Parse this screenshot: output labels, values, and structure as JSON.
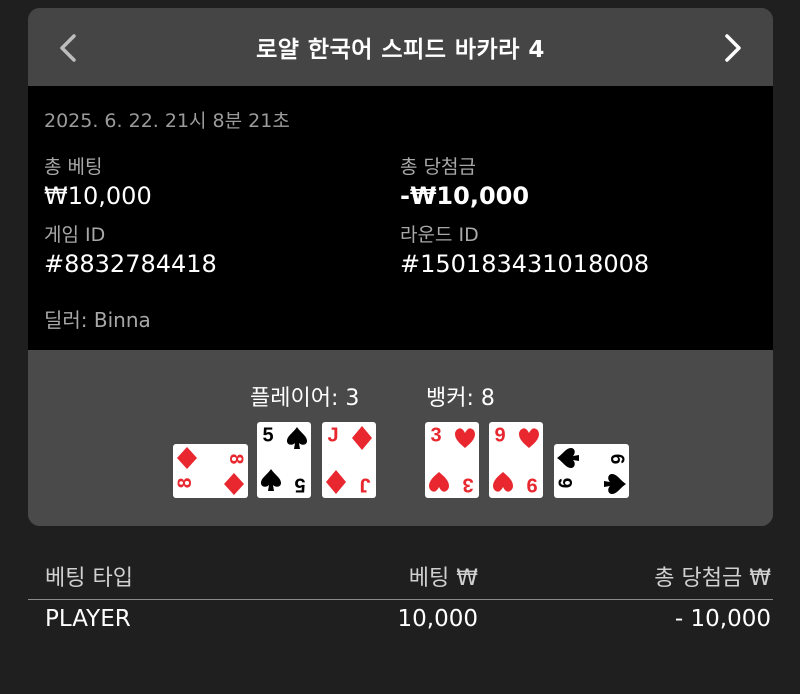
{
  "header": {
    "title": "로얄 한국어 스피드 바카라 4",
    "prev_icon": "chevron-left-icon",
    "next_icon": "chevron-right-icon"
  },
  "info": {
    "timestamp": "2025. 6. 22. 21시 8분 21초",
    "total_bet_label": "총 베팅",
    "total_bet_value": "₩10,000",
    "total_win_label": "총 당첨금",
    "total_win_value": "-₩10,000",
    "game_id_label": "게임 ID",
    "game_id_value": "#8832784418",
    "round_id_label": "라운드 ID",
    "round_id_value": "#150183431018008",
    "dealer": "딜러: Binna"
  },
  "hands": {
    "player_label": "플레이어: 3",
    "banker_label": "뱅커: 8",
    "player_cards": [
      {
        "rank": "8",
        "suit": "diamond",
        "orientation": "sideways"
      },
      {
        "rank": "5",
        "suit": "spade",
        "orientation": "upright"
      },
      {
        "rank": "J",
        "suit": "diamond",
        "orientation": "upright"
      }
    ],
    "banker_cards": [
      {
        "rank": "3",
        "suit": "heart",
        "orientation": "upright"
      },
      {
        "rank": "9",
        "suit": "heart",
        "orientation": "upright"
      },
      {
        "rank": "6",
        "suit": "spade",
        "orientation": "sideways"
      }
    ]
  },
  "table": {
    "col_bet_type": "베팅 타입",
    "col_bet": "베팅 ₩",
    "col_total_win": "총 당첨금 ₩",
    "rows": [
      {
        "bet_type": "PLAYER",
        "bet": "10,000",
        "total_win": "- 10,000"
      }
    ]
  },
  "colors": {
    "red_suit": "#e8272f",
    "black_suit": "#000000",
    "background": "#1f1f1f",
    "panel": "#4a4a4a",
    "info_bg": "#000000"
  }
}
